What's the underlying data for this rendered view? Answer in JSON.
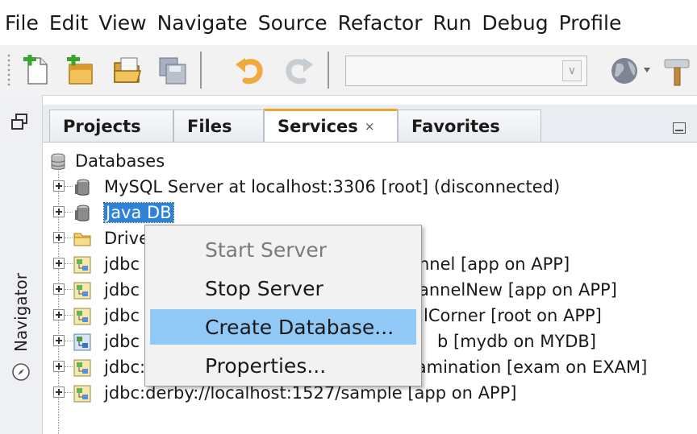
{
  "menubar": {
    "items": [
      "File",
      "Edit",
      "View",
      "Navigate",
      "Source",
      "Refactor",
      "Run",
      "Debug",
      "Profile"
    ]
  },
  "toolbar": {
    "buttons": [
      "new-file-icon",
      "new-project-icon",
      "open-project-icon",
      "save-all-icon",
      "undo-icon",
      "redo-icon",
      "globe-icon",
      "build-hammer-icon"
    ],
    "config_combo_value": ""
  },
  "gutter": {
    "navigator_label": "Navigator"
  },
  "tabs": [
    {
      "label": "Projects",
      "active": false
    },
    {
      "label": "Files",
      "active": false
    },
    {
      "label": "Services",
      "active": true,
      "close": "×"
    },
    {
      "label": "Favorites",
      "active": false
    }
  ],
  "tree": {
    "root": "Databases",
    "nodes": [
      {
        "text": "MySQL Server at localhost:3306 [root] (disconnected)",
        "icon": "database-server-icon"
      },
      {
        "text": "Java DB",
        "icon": "database-server-icon",
        "selected": true
      },
      {
        "text": "Drivers",
        "icon": "folder-icon"
      },
      {
        "text": "jdbc:derby://localhost:1527/OnlineCarRentalChannel [app on APP]",
        "visible_suffix": "nnel [app on APP]",
        "icon": "connection-icon"
      },
      {
        "text": "jdbc:derby://localhost:1527/OnlineCarRentalChannelNew [app on APP]",
        "visible_suffix": "annelNew [app on APP]",
        "icon": "connection-icon"
      },
      {
        "text": "jdbc:derby://localhost:1527/CarRentalCorner [root on APP]",
        "visible_suffix": "lCorner [root on APP]",
        "icon": "connection-icon"
      },
      {
        "text": "jdbc:derby://localhost:1527/mydb [mydb on MYDB]",
        "visible_suffix": "b [mydb on MYDB]",
        "icon": "connection-connected-icon"
      },
      {
        "text": "jdbc:derby://localhost:1527/OnlineExamination [exam on EXAM]",
        "icon": "connection-icon"
      },
      {
        "text": "jdbc:derby://localhost:1527/sample [app on APP]",
        "icon": "connection-icon"
      }
    ],
    "row_prefix": "jdbc"
  },
  "context_menu": {
    "items": [
      {
        "label": "Start Server",
        "enabled": false
      },
      {
        "label": "Stop Server",
        "enabled": true
      },
      {
        "label": "Create Database...",
        "enabled": true,
        "hover": true
      },
      {
        "label": "Properties...",
        "enabled": true
      }
    ]
  },
  "colors": {
    "selection": "#2f82d6",
    "menu_hover": "#90c8f6",
    "active_tab_accent": "#f3a32a"
  }
}
